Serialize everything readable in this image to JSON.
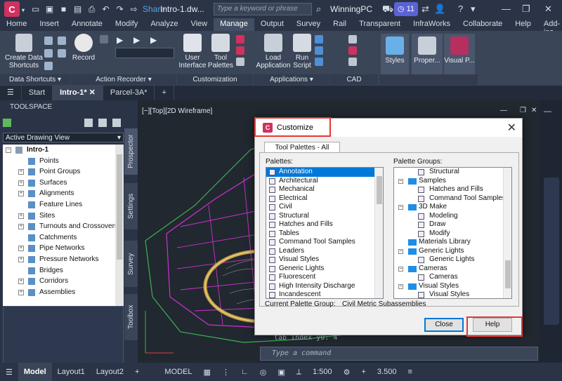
{
  "titlebar": {
    "app_logo": "C",
    "share_label": "Share",
    "document_title": "Intro-1.dw...",
    "search_placeholder": "Type a keyword or phrase",
    "user_name": "WinningPC",
    "badge_count": "11"
  },
  "ribbon_tabs": [
    "Home",
    "Insert",
    "Annotate",
    "Modify",
    "Analyze",
    "View",
    "Manage",
    "Output",
    "Survey",
    "Rail",
    "Transparent",
    "InfraWorks",
    "Collaborate",
    "Help",
    "Add-ins"
  ],
  "ribbon_active_tab": "Manage",
  "ribbon": {
    "buttons": {
      "create_data_shortcuts": "Create Data Shortcuts",
      "record": "Record",
      "user_interface": "User Interface",
      "tool_palettes": "Tool Palettes",
      "load_application": "Load Application",
      "run_script": "Run Script",
      "styles": "Styles",
      "properties": "Proper...",
      "visual_p": "Visual P..."
    },
    "panels": {
      "data_shortcuts": "Data Shortcuts",
      "action_recorder": "Action Recorder",
      "customization": "Customization",
      "applications": "Applications",
      "cad_standards": "CAD Standards"
    }
  },
  "doc_tabs": [
    {
      "label": "Start",
      "active": false
    },
    {
      "label": "Intro-1*",
      "active": true
    },
    {
      "label": "Parcel-3A*",
      "active": false
    }
  ],
  "toolspace": {
    "title": "TOOLSPACE",
    "view_dropdown": "Active Drawing View",
    "tree_root": "Intro-1",
    "tree_items": [
      "Points",
      "Point Groups",
      "Surfaces",
      "Alignments",
      "Feature Lines",
      "Sites",
      "Turnouts and Crossovers",
      "Catchments",
      "Pipe Networks",
      "Pressure Networks",
      "Bridges",
      "Corridors",
      "Assemblies"
    ],
    "side_tabs": [
      "Prospector",
      "Settings",
      "Survey",
      "Toolbox"
    ]
  },
  "drawing": {
    "view_label": "[−][Top][2D Wireframe]",
    "command_history": "tab index y0: 4",
    "command_placeholder": "Type a command"
  },
  "statusbar": {
    "model_tab": "Model",
    "layout1": "Layout1",
    "layout2": "Layout2",
    "model_space": "MODEL",
    "scale": "1:500",
    "elevation": "3.500"
  },
  "dialog": {
    "title": "Customize",
    "tab": "Tool Palettes - All Palettes",
    "palettes_label": "Palettes:",
    "palettes": [
      "Annotation",
      "Architectural",
      "Mechanical",
      "Electrical",
      "Civil",
      "Structural",
      "Hatches and Fills",
      "Tables",
      "Command Tool Samples",
      "Leaders",
      "Visual Styles",
      "Generic Lights",
      "Fluorescent",
      "High Intensity Discharge",
      "Incandescent"
    ],
    "palettes_selected": "Annotation",
    "palette_groups_label": "Palette Groups:",
    "palette_groups": [
      {
        "label": "Structural",
        "level": 2,
        "kind": "palette"
      },
      {
        "label": "Samples",
        "level": 1,
        "kind": "group"
      },
      {
        "label": "Hatches and Fills",
        "level": 2,
        "kind": "palette"
      },
      {
        "label": "Command Tool Samples",
        "level": 2,
        "kind": "palette"
      },
      {
        "label": "3D Make",
        "level": 1,
        "kind": "group"
      },
      {
        "label": "Modeling",
        "level": 2,
        "kind": "palette"
      },
      {
        "label": "Draw",
        "level": 2,
        "kind": "palette"
      },
      {
        "label": "Modify",
        "level": 2,
        "kind": "palette"
      },
      {
        "label": "Materials Library",
        "level": 1,
        "kind": "group-leaf"
      },
      {
        "label": "Generic Lights",
        "level": 1,
        "kind": "group"
      },
      {
        "label": "Generic Lights",
        "level": 2,
        "kind": "palette"
      },
      {
        "label": "Cameras",
        "level": 1,
        "kind": "group"
      },
      {
        "label": "Cameras",
        "level": 2,
        "kind": "palette"
      },
      {
        "label": "Visual Styles",
        "level": 1,
        "kind": "group"
      },
      {
        "label": "Visual Styles",
        "level": 2,
        "kind": "palette"
      }
    ],
    "current_group_label": "Current Palette Group:",
    "current_group_value": "Civil Metric Subassemblies",
    "close_button": "Close",
    "help_button": "Help"
  },
  "colors": {
    "accent": "#d0315f",
    "selection": "#0078d7",
    "highlight_box": "#e53935",
    "folder": "#1e8ee6"
  }
}
